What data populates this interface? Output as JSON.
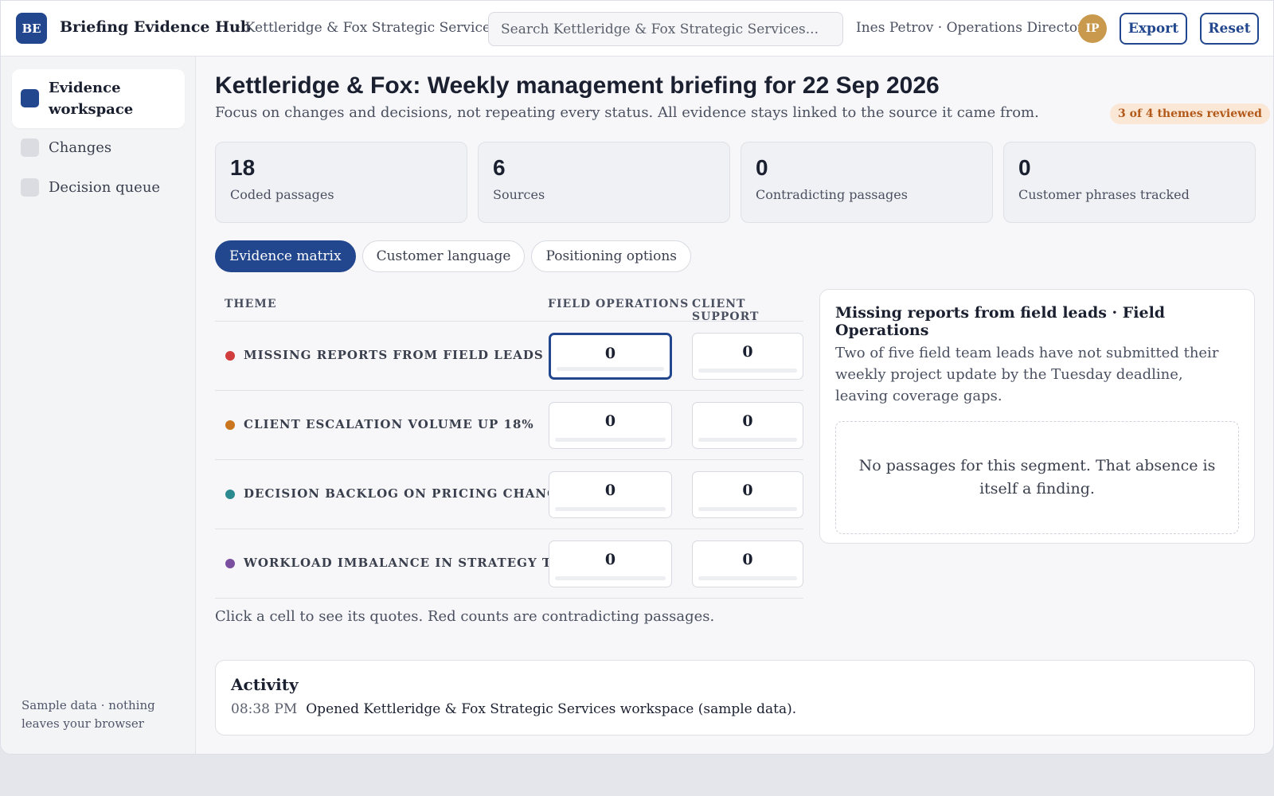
{
  "header": {
    "logo": "BE",
    "app_title": "Briefing Evidence Hub",
    "org": "· Kettleridge & Fox Strategic Services",
    "search_placeholder": "Search Kettleridge & Fox Strategic Services...",
    "user": "Ines Petrov · Operations Director",
    "avatar": "IP",
    "export_label": "Export",
    "reset_label": "Reset"
  },
  "sidebar": {
    "items": [
      {
        "label": "Evidence workspace",
        "active": true
      },
      {
        "label": "Changes",
        "active": false
      },
      {
        "label": "Decision queue",
        "active": false
      }
    ],
    "footer": "Sample data · nothing leaves your browser"
  },
  "main": {
    "title": "Kettleridge & Fox: Weekly management briefing for 22 Sep 2026",
    "subtitle": "Focus on changes and decisions, not repeating every status. All evidence stays linked to the source it came from.",
    "review_badge": "3 of 4 themes reviewed",
    "stats": [
      {
        "value": "18",
        "label": "Coded passages"
      },
      {
        "value": "6",
        "label": "Sources"
      },
      {
        "value": "0",
        "label": "Contradicting passages"
      },
      {
        "value": "0",
        "label": "Customer phrases tracked"
      }
    ],
    "tabs": [
      {
        "label": "Evidence matrix",
        "active": true
      },
      {
        "label": "Customer language",
        "active": false
      },
      {
        "label": "Positioning options",
        "active": false
      }
    ],
    "matrix": {
      "headers": {
        "theme": "THEME",
        "col1": "FIELD OPERATIONS",
        "col2": "CLIENT SUPPORT"
      },
      "rows": [
        {
          "theme": "MISSING REPORTS FROM FIELD LEADS",
          "color": "#d13c3c",
          "field_ops": "0",
          "client_support": "0"
        },
        {
          "theme": "CLIENT ESCALATION VOLUME UP 18%",
          "color": "#c9761e",
          "field_ops": "0",
          "client_support": "0"
        },
        {
          "theme": "DECISION BACKLOG ON PRICING CHANGES",
          "color": "#2a8a8f",
          "field_ops": "0",
          "client_support": "0"
        },
        {
          "theme": "WORKLOAD IMBALANCE IN STRATEGY TEAM",
          "color": "#7a4fa0",
          "field_ops": "0",
          "client_support": "0"
        }
      ],
      "note": "Click a cell to see its quotes. Red counts are contradicting passages."
    },
    "detail": {
      "title": "Missing reports from field leads · Field Operations",
      "body": "Two of five field team leads have not submitted their weekly project update by the Tuesday deadline, leaving coverage gaps.",
      "empty": "No passages for this segment. That absence is itself a finding."
    },
    "activity": {
      "title": "Activity",
      "time": "08:38 PM",
      "text": "Opened Kettleridge & Fox Strategic Services workspace (sample data)."
    }
  }
}
